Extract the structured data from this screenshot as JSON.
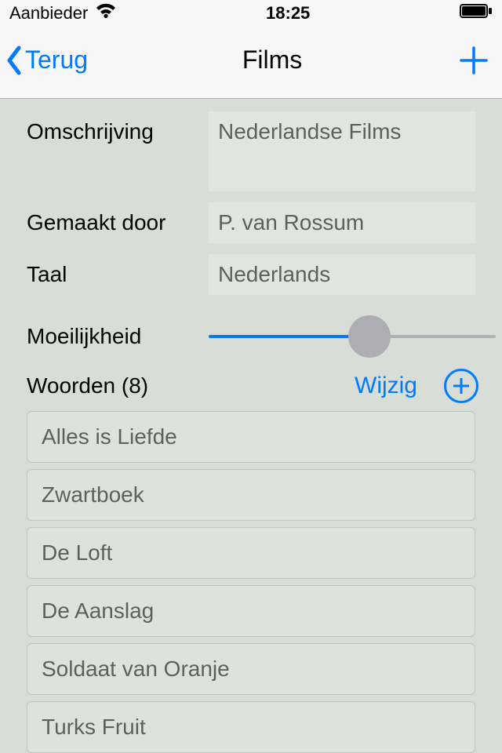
{
  "status": {
    "carrier": "Aanbieder",
    "time": "18:25"
  },
  "nav": {
    "back": "Terug",
    "title": "Films"
  },
  "form": {
    "description_label": "Omschrijving",
    "description_value": "Nederlandse Films",
    "author_label": "Gemaakt door",
    "author_value": "P. van Rossum",
    "language_label": "Taal",
    "language_value": "Nederlands",
    "difficulty_label": "Moeilijkheid",
    "difficulty_percent": 56
  },
  "words": {
    "header": "Woorden (8)",
    "edit_label": "Wijzig",
    "items": [
      "Alles is Liefde",
      "Zwartboek",
      "De Loft",
      "De Aanslag",
      "Soldaat van Oranje",
      "Turks Fruit"
    ]
  }
}
